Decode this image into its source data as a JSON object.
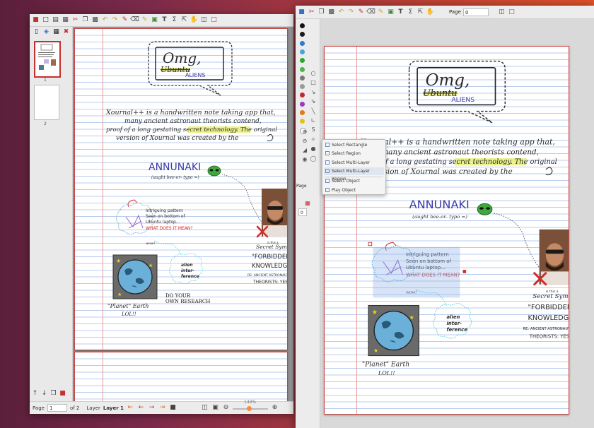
{
  "window1": {
    "thumbnails": [
      {
        "number": "1"
      },
      {
        "number": "2"
      }
    ],
    "status": {
      "page_label": "Page",
      "page_value": "1",
      "of_label": "of 2",
      "layer_label": "Layer",
      "layer_value": "Layer 1",
      "zoom": "149%"
    }
  },
  "window2": {
    "toolbar": {
      "page_label": "Page",
      "page_value": "0"
    },
    "palette": {
      "page_label": "Page",
      "page_value": "0",
      "colors": [
        "#111111",
        "#1a1a1a",
        "#2b7cd3",
        "#4aa0e0",
        "#2ca62c",
        "#45b845",
        "#7a7a7a",
        "#9a9a9a",
        "#c0282a",
        "#9a3ac0",
        "#e07a1a",
        "#e0c21a",
        "#ffffff"
      ]
    },
    "menu": {
      "items": [
        {
          "label": "Select Rectangle",
          "highlight": false
        },
        {
          "label": "Select Region",
          "highlight": false
        },
        {
          "label": "Select Multi-Layer Rectangle",
          "highlight": false
        },
        {
          "label": "Select Multi-Layer Region",
          "highlight": true
        },
        {
          "label": "Select Object",
          "highlight": false
        },
        {
          "label": "Play Object",
          "highlight": false
        }
      ]
    }
  },
  "note": {
    "title_line1": "Omg,",
    "title_line2": "Ubuntu",
    "title_line3": "ALIENS",
    "para_line1": "Xournal++ is a handwritten note taking app that,",
    "para_line2": "many ancient astronaut theorists contend,",
    "para_line3": "proof of a long gestating secret technology. The original",
    "para_line4": "version of Xournal was created by the",
    "annunaki": "ANNUNAKI",
    "annunaki_sub": "(aught bee-or- typo =)",
    "pattern_text_line1": "Intriguing pattern",
    "pattern_text_line2": "Seen on bottom of",
    "pattern_text_line3": "Ubuntu laptop...",
    "pattern_text_line4": "WHAT DOES IT MEAN?",
    "wow": "wow!",
    "alien_line1": "alien",
    "alien_line2": "inter-",
    "alien_line3": "ference",
    "secret_small": "is this a",
    "secret_line1": "Secret Symbol of",
    "secret_line2": "\"FORBIDDEN",
    "secret_line3": "KNOWLEDGE\"?",
    "secret_line4": "RE: ANCIENT ASTRONAUT",
    "secret_line5": "THEORISTS: YES!!",
    "planet_line1": "\"Planet\" Earth",
    "planet_line2": "LOL!!",
    "research_line1": "DO YOUR",
    "research_line2": "OWN RESEARCH"
  }
}
